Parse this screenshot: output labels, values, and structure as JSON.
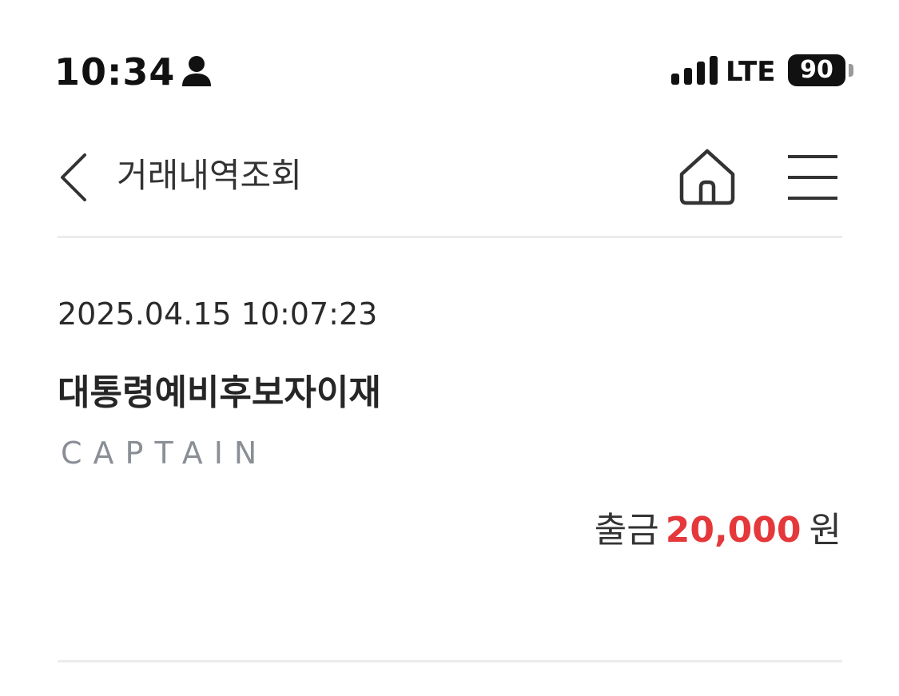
{
  "status_bar": {
    "time": "10:34",
    "network": "LTE",
    "battery_level": "90",
    "icons": [
      "person-icon",
      "signal-icon"
    ]
  },
  "header": {
    "title": "거래내역조회",
    "icons": [
      "chevron-left-icon",
      "home-icon",
      "hamburger-menu-icon"
    ]
  },
  "transaction": {
    "datetime": "2025.04.15 10:07:23",
    "name": "대통령예비후보자이재",
    "memo": "CAPTAIN",
    "type_label": "출금",
    "amount": "20,000",
    "currency": "원"
  },
  "colors": {
    "amount": "#e5383b",
    "memo": "#8a8f96",
    "divider": "#ececec"
  }
}
